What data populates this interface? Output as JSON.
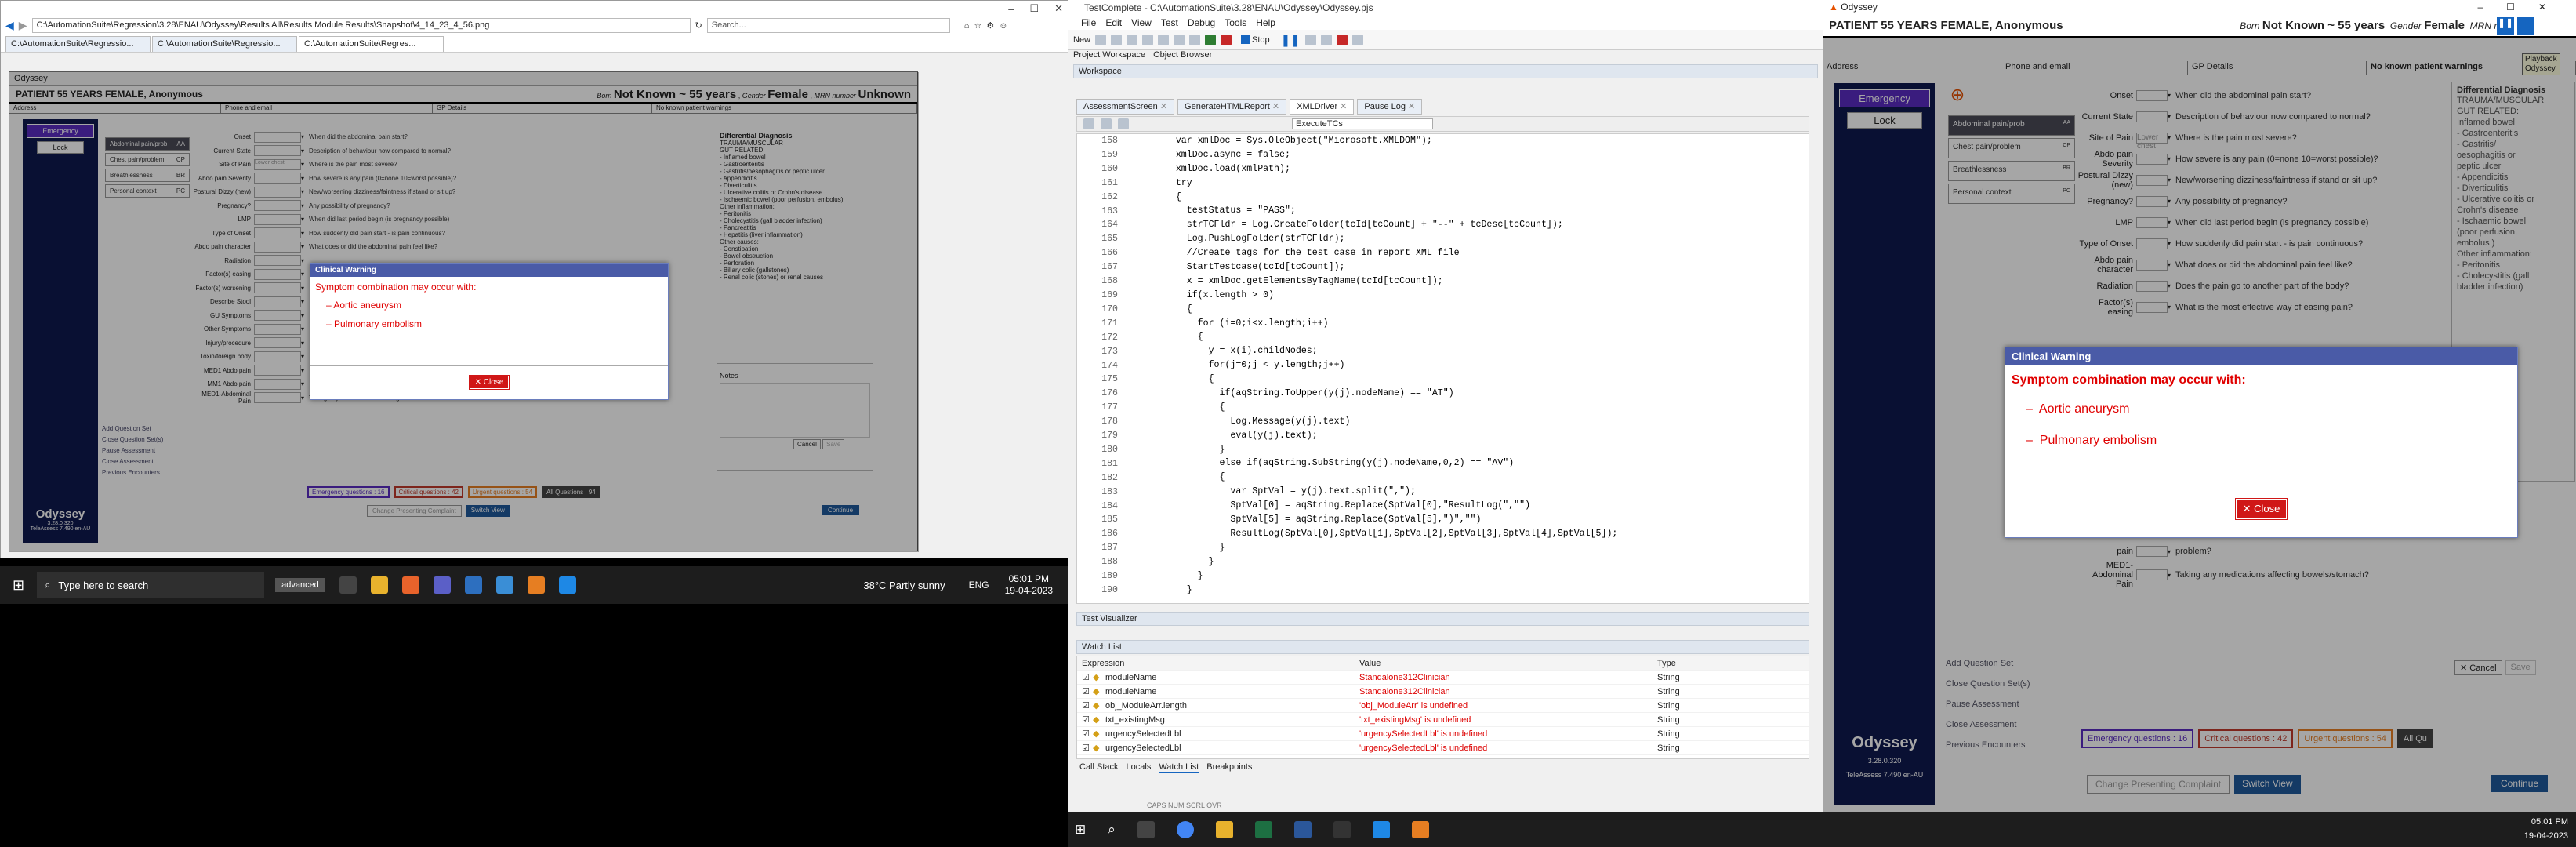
{
  "m1": {
    "ie_title_buttons": [
      "–",
      "☐",
      "✕"
    ],
    "url": "C:\\AutomationSuite\\Regression\\3.28\\ENAU\\Odyssey\\Results All\\Results Module Results\\Snapshot\\4_14_23_4_56.png",
    "search_placeholder": "Search...",
    "tabs": [
      "C:\\AutomationSuite\\Regressio...",
      "C:\\AutomationSuite\\Regressio...",
      "C:\\AutomationSuite\\Regres..."
    ],
    "ody_title": "Odyssey",
    "patient": "PATIENT 55 YEARS FEMALE, Anonymous",
    "born_label": "Born",
    "born_value": "Not Known ~ 55 years",
    "gender_label": "Gender",
    "gender_value": "Female",
    "mrn_label": "MRN number",
    "mrn_value": "Unknown",
    "info": [
      "Address",
      "Phone and email",
      "GP Details",
      "No known patient warnings"
    ],
    "emergency": "Emergency",
    "lock": "Lock",
    "cats": [
      {
        "label": "Abdominal pain/prob",
        "code": "AA"
      },
      {
        "label": "Chest pain/problem",
        "code": "CP"
      },
      {
        "label": "Breathlessness",
        "code": "BR"
      },
      {
        "label": "Personal context",
        "code": "PC"
      }
    ],
    "rows": [
      {
        "label": "Onset",
        "value": "",
        "q": "When did the abdominal pain start?"
      },
      {
        "label": "Current State",
        "value": "",
        "q": "Description of behaviour now compared to normal?"
      },
      {
        "label": "Site of Pain",
        "value": "Lower chest",
        "q": "Where is the pain most severe?"
      },
      {
        "label": "Abdo pain Severity",
        "value": "",
        "q": "How severe is any pain (0=none 10=worst possible)?"
      },
      {
        "label": "Postural Dizzy (new)",
        "value": "",
        "q": "New/worsening dizziness/faintness if stand or sit up?"
      },
      {
        "label": "Pregnancy?",
        "value": "",
        "q": "Any possibility of pregnancy?"
      },
      {
        "label": "LMP",
        "value": "",
        "q": "When did last period begin (is pregnancy possible)"
      },
      {
        "label": "Type of Onset",
        "value": "",
        "q": "How suddenly did pain start - is pain continuous?"
      },
      {
        "label": "Abdo pain character",
        "value": "",
        "q": "What does or did the abdominal pain feel like?"
      },
      {
        "label": "Radiation",
        "value": "",
        "q": ""
      },
      {
        "label": "Factor(s) easing",
        "value": "",
        "q": ""
      },
      {
        "label": "Factor(s) worsening",
        "value": "",
        "q": ""
      },
      {
        "label": "Describe Stool",
        "value": "",
        "q": ""
      },
      {
        "label": "GU Symptoms",
        "value": "",
        "q": ""
      },
      {
        "label": "Other Symptoms",
        "value": "",
        "q": ""
      },
      {
        "label": "Injury/procedure",
        "value": "",
        "q": ""
      },
      {
        "label": "Toxin/foreign body",
        "value": "",
        "q": ""
      },
      {
        "label": "MED1 Abdo pain",
        "value": "",
        "q": ""
      },
      {
        "label": "MM1 Abdo pain",
        "value": "",
        "q": ""
      },
      {
        "label": "MED1-Abdominal Pain",
        "value": "",
        "q": "Taking any medications affecting bowels/stomach?"
      }
    ],
    "dd_header": "Differential Diagnosis",
    "dd_lines": [
      "TRAUMA/MUSCULAR",
      "",
      "GUT RELATED:",
      "- Inflamed bowel",
      "- Gastroenteritis",
      "- Gastritis/oesophagitis or peptic ulcer",
      "- Appendicitis",
      "- Diverticulitis",
      "- Ulcerative colitis or Crohn's disease",
      "- Ischaemic bowel (poor perfusion, embolus)",
      "",
      "Other inflammation:",
      "- Peritonitis",
      "- Cholecystitis (gall bladder infection)",
      "- Pancreatitis",
      "- Hepatitis (liver inflammation)",
      "",
      "Other causes:",
      "- Constipation",
      "- Bowel obstruction",
      "- Perforation",
      "- Biliary colic (gallstones)",
      "- Renal colic (stones) or renal causes"
    ],
    "notes": "Notes",
    "links": [
      "Add Question Set",
      "Close Question Set(s)",
      "Pause Assessment",
      "Close Assessment",
      "Previous Encounters"
    ],
    "counts": [
      "Emergency questions : 16",
      "Critical questions : 42",
      "Urgent questions : 54",
      "All Questions : 94"
    ],
    "change_btn": "Change Presenting Complaint",
    "switch_view": "Switch View",
    "cancel": "Cancel",
    "save": "Save",
    "continue": "Continue",
    "brand": "Odyssey",
    "version": "3.28.0.320",
    "version2": "TeleAssess 7.490 en-AU",
    "dlg": {
      "title": "Clinical Warning",
      "text": "Symptom combination may occur with:",
      "items": [
        "Aortic aneurysm",
        "Pulmonary embolism"
      ],
      "close": "Close"
    },
    "taskbar": {
      "search": "Type here to search",
      "app": "advanced",
      "weather": "38°C  Partly sunny",
      "lang": "ENG",
      "time": "05:01 PM",
      "date": "19-04-2023"
    }
  },
  "m2": {
    "title": "TestComplete - C:\\AutomationSuite\\3.28\\ENAU\\Odyssey\\Odyssey.pjs",
    "menu": [
      "File",
      "Edit",
      "View",
      "Test",
      "Debug",
      "Tools",
      "Help"
    ],
    "toolbar": {
      "new": "New",
      "stop": "Stop"
    },
    "pane_tabs": [
      "Project Workspace",
      "Object Browser"
    ],
    "workspace": "Workspace",
    "doc_tabs": [
      "AssessmentScreen",
      "GenerateHTMLReport",
      "XMLDriver",
      "Pause Log"
    ],
    "func_select": "ExecuteTCs",
    "lines": [
      "158",
      "159",
      "160",
      "161",
      "162",
      "163",
      "164",
      "165",
      "166",
      "167",
      "168",
      "169",
      "170",
      "171",
      "172",
      "173",
      "174",
      "175",
      "176",
      "177",
      "178",
      "179",
      "180",
      "181",
      "182",
      "183",
      "184",
      "185",
      "186",
      "187",
      "188",
      "189",
      "190"
    ],
    "code": [
      "    var xmlDoc = Sys.OleObject(\"Microsoft.XMLDOM\");",
      "    xmlDoc.async = false;",
      "    xmlDoc.load(xmlPath);",
      "    try",
      "    {",
      "      testStatus = \"PASS\";",
      "      strTCFldr = Log.CreateFolder(tcId[tcCount] + \"--\" + tcDesc[tcCount]);",
      "      Log.PushLogFolder(strTCFldr);",
      "      //Create tags for the test case in report XML file",
      "      StartTestcase(tcId[tcCount]);",
      "      x = xmlDoc.getElementsByTagName(tcId[tcCount]);",
      "      if(x.length > 0)",
      "      {",
      "        for (i=0;i<x.length;i++)",
      "        {",
      "          y = x(i).childNodes;",
      "          for(j=0;j < y.length;j++)",
      "          {",
      "            if(aqString.ToUpper(y(j).nodeName) == \"AT\")",
      "            {",
      "              Log.Message(y(j).text)",
      "              eval(y(j).text);",
      "            }",
      "            else if(aqString.SubString(y(j).nodeName,0,2) == \"AV\")",
      "            {",
      "              var SptVal = y(j).text.split(\",\");",
      "              SptVal[0] = aqString.Replace(SptVal[0],\"ResultLog(\",\"\")",
      "              SptVal[5] = aqString.Replace(SptVal[5],\")\",\"\")",
      "              ResultLog(SptVal[0],SptVal[1],SptVal[2],SptVal[3],SptVal[4],SptVal[5]);",
      "            }",
      "          }",
      "        }",
      "      }"
    ],
    "visualizer": "Test Visualizer",
    "watch_title": "Watch List",
    "watch_cols": [
      "Expression",
      "Value",
      "Type"
    ],
    "watch": [
      {
        "e": "moduleName",
        "v": "Standalone312Clinician",
        "t": "String"
      },
      {
        "e": "moduleName",
        "v": "Standalone312Clinician",
        "t": "String"
      },
      {
        "e": "obj_ModuleArr.length",
        "v": "'obj_ModuleArr' is undefined",
        "t": "String"
      },
      {
        "e": "txt_existingMsg",
        "v": "'txt_existingMsg' is undefined",
        "t": "String"
      },
      {
        "e": "urgencySelectedLbl",
        "v": "'urgencySelectedLbl' is undefined",
        "t": "String"
      },
      {
        "e": "urgencySelectedLbl",
        "v": "'urgencySelectedLbl' is undefined",
        "t": "String"
      }
    ],
    "bottom_tabs": [
      "Call Stack",
      "Locals",
      "Watch List",
      "Breakpoints"
    ],
    "status": "CAPS  NUM  SCRL  OVR"
  },
  "m3": {
    "title": "Odyssey",
    "patient": "PATIENT 55 YEARS FEMALE, Anonymous",
    "born_label": "Born",
    "born_value": "Not Known ~ 55 years",
    "gender_label": "Gender",
    "gender_value": "Female",
    "mrn_label": "MRN n",
    "tooltip": [
      "Playback",
      "Odyssey"
    ],
    "info": [
      "Address",
      "Phone and email",
      "GP Details",
      "No known patient warnings"
    ],
    "emergency": "Emergency",
    "lock": "Lock",
    "cats": [
      {
        "label": "Abdominal pain/prob",
        "code": "AA"
      },
      {
        "label": "Chest pain/problem",
        "code": "CP"
      },
      {
        "label": "Breathlessness",
        "code": "BR"
      },
      {
        "label": "Personal context",
        "code": "PC"
      }
    ],
    "rows": [
      {
        "label": "Onset",
        "value": "",
        "q": "When did the abdominal pain start?"
      },
      {
        "label": "Current State",
        "value": "",
        "q": "Description of behaviour now compared to normal?"
      },
      {
        "label": "Site of Pain",
        "value": "Lower chest",
        "q": "Where is the pain most severe?"
      },
      {
        "label": "Abdo pain Severity",
        "value": "",
        "q": "How severe is any pain (0=none 10=worst possible)?"
      },
      {
        "label": "Postural Dizzy (new)",
        "value": "",
        "q": "New/worsening dizziness/faintness if stand or sit up?"
      },
      {
        "label": "Pregnancy?",
        "value": "",
        "q": "Any possibility of pregnancy?"
      },
      {
        "label": "LMP",
        "value": "",
        "q": "When did last period begin (is pregnancy possible)"
      },
      {
        "label": "Type of Onset",
        "value": "",
        "q": "How suddenly did pain start - is pain continuous?"
      },
      {
        "label": "Abdo pain character",
        "value": "",
        "q": "What does or did the abdominal pain feel like?"
      },
      {
        "label": "Radiation",
        "value": "",
        "q": "Does the pain go to another part of the body?"
      },
      {
        "label": "Factor(s) easing",
        "value": "",
        "q": "What is the most effective way of easing pain?"
      }
    ],
    "rows_low": [
      {
        "label": "pain",
        "value": "",
        "q": "problem?"
      },
      {
        "label": "MED1-Abdominal Pain",
        "value": "",
        "q": "Taking any medications affecting bowels/stomach?"
      }
    ],
    "dd_header": "Differential Diagnosis",
    "dd_lines": [
      "TRAUMA/MUSCULAR",
      "",
      "GUT RELATED:",
      "Inflamed bowel",
      "- Gastroenteritis",
      "- Gastritis/",
      "oesophagitis or",
      "peptic ulcer",
      "- Appendicitis",
      "- Diverticulitis",
      "- Ulcerative colitis or",
      "Crohn's disease",
      "- Ischaemic bowel",
      "(poor perfusion,",
      "embolus )",
      "",
      "Other inflammation:",
      "- Peritonitis",
      "- Cholecystitis (gall",
      "bladder infection)"
    ],
    "links": [
      "Add Question Set",
      "Close Question Set(s)",
      "Pause Assessment",
      "Close Assessment",
      "Previous Encounters"
    ],
    "counts": [
      "Emergency questions : 16",
      "Critical questions : 42",
      "Urgent questions : 54",
      "All Qu"
    ],
    "change_btn": "Change Presenting Complaint",
    "switch_view": "Switch View",
    "cancel": "Cancel",
    "save": "Save",
    "continue": "Continue",
    "brand": "Odyssey",
    "version": "3.28.0.320",
    "version2": "TeleAssess 7.490 en-AU",
    "dlg": {
      "title": "Clinical Warning",
      "text": "Symptom combination may occur with:",
      "items": [
        "Aortic aneurysm",
        "Pulmonary embolism"
      ],
      "close": "Close"
    },
    "time": "05:01 PM",
    "date": "19-04-2023"
  }
}
